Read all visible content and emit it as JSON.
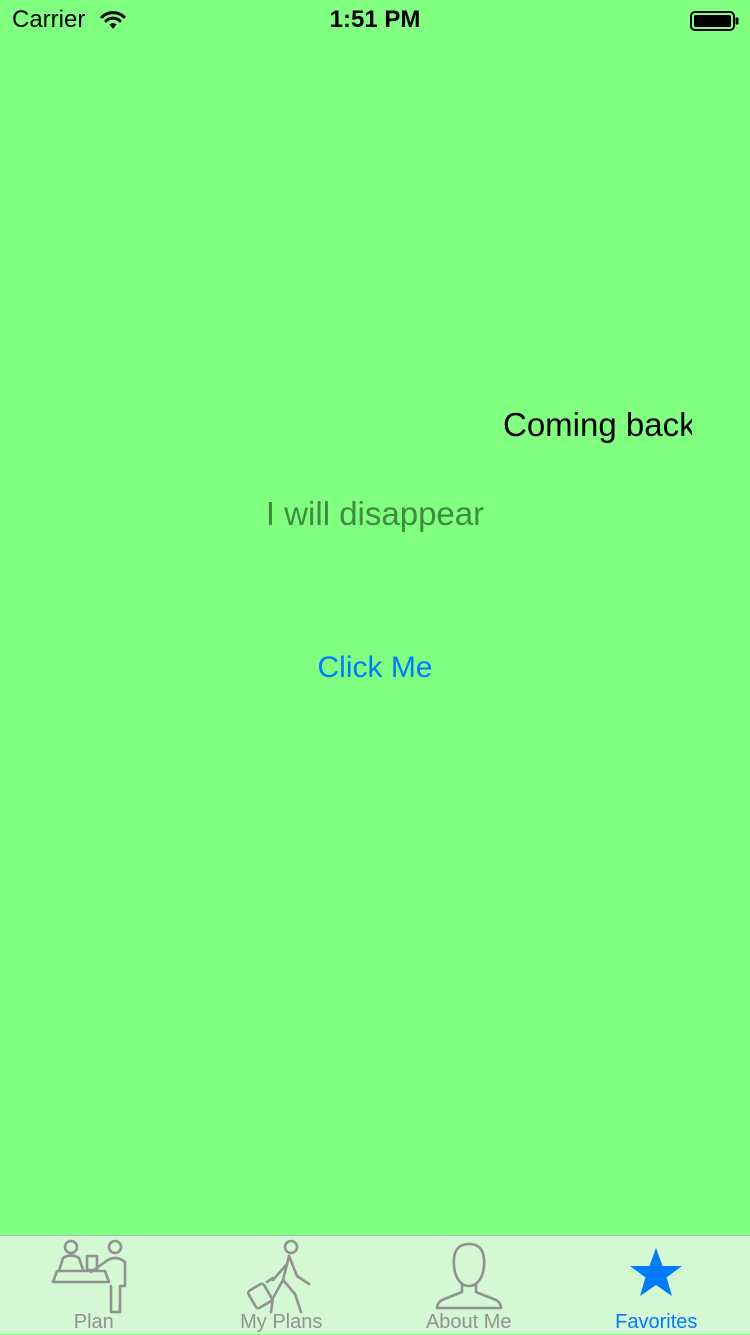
{
  "status_bar": {
    "carrier": "Carrier",
    "time": "1:51 PM"
  },
  "content": {
    "coming_back_label": "Coming back",
    "disappear_label": "I will disappear",
    "click_button_label": "Click Me"
  },
  "tab_bar": {
    "tabs": [
      {
        "label": "Plan",
        "icon": "check-in-desk-icon",
        "active": false
      },
      {
        "label": "My Plans",
        "icon": "traveler-luggage-icon",
        "active": false
      },
      {
        "label": "About Me",
        "icon": "person-icon",
        "active": false
      },
      {
        "label": "Favorites",
        "icon": "star-icon",
        "active": true
      }
    ]
  },
  "colors": {
    "background": "#80FF80",
    "tab_bar_background": "#D3F8D3",
    "accent": "#007AFF",
    "inactive_tab": "#929292",
    "disappear_text": "#3F8B3F"
  }
}
